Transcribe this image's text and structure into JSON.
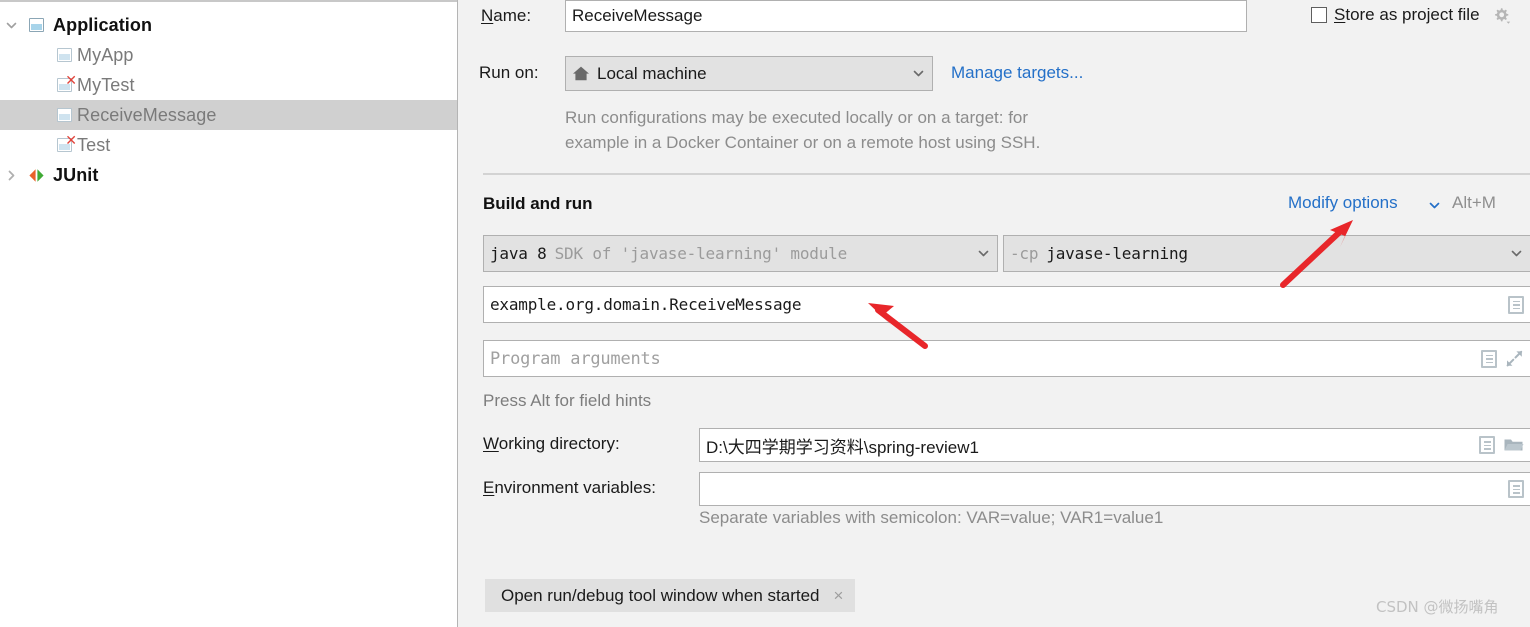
{
  "sidebar": {
    "items": [
      {
        "label": "Application",
        "icon": "window-icon",
        "indent": 0,
        "expander": "chevron-down-icon",
        "bold": true,
        "selected": false,
        "error": false
      },
      {
        "label": "MyApp",
        "icon": "window-icon",
        "indent": 1,
        "expander": "",
        "bold": false,
        "selected": false,
        "error": false
      },
      {
        "label": "MyTest",
        "icon": "window-error-icon",
        "indent": 1,
        "expander": "",
        "bold": false,
        "selected": false,
        "error": true
      },
      {
        "label": "ReceiveMessage",
        "icon": "window-icon",
        "indent": 1,
        "expander": "",
        "bold": false,
        "selected": true,
        "error": false
      },
      {
        "label": "Test",
        "icon": "window-error-icon",
        "indent": 1,
        "expander": "",
        "bold": false,
        "selected": false,
        "error": true
      },
      {
        "label": "JUnit",
        "icon": "junit-icon",
        "indent": 0,
        "expander": "chevron-right-icon",
        "bold": true,
        "selected": false,
        "error": false
      }
    ]
  },
  "form": {
    "name_label": "Name:",
    "name_value": "ReceiveMessage",
    "store_as_project_file_label": "Store as project file",
    "store_as_project_file_checked": false,
    "run_on_label": "Run on:",
    "run_on_value": "Local machine",
    "manage_targets_link": "Manage targets...",
    "run_on_description_line1": "Run configurations may be executed locally or on a target: for",
    "run_on_description_line2": "example in a Docker Container or on a remote host using SSH.",
    "build_and_run_title": "Build and run",
    "modify_options_link": "Modify options",
    "modify_options_shortcut": "Alt+M",
    "jdk_value_strong": "java 8",
    "jdk_value_dim": "SDK of 'javase-learning' module",
    "classpath_value_dim": "-cp",
    "classpath_value_strong": "javase-learning",
    "main_class_value": "example.org.domain.ReceiveMessage",
    "program_arguments_placeholder": "Program arguments",
    "field_hints_text": "Press Alt for field hints",
    "working_directory_label": "Working directory:",
    "working_directory_value": "D:\\大四学期学习资料\\spring-review1",
    "environment_variables_label": "Environment variables:",
    "environment_variables_value": "",
    "environment_variables_hint": "Separate variables with semicolon: VAR=value; VAR1=value1",
    "open_tool_window_chip_label": "Open run/debug tool window when started",
    "open_tool_window_chip_close": "×"
  },
  "watermark": {
    "text": "CSDN @微扬嘴角"
  },
  "colors": {
    "accent_link": "#2470c8",
    "annotation_arrow": "#e8262a",
    "selection": "#d0d0d0",
    "panel_bg": "#f2f2f2",
    "error_marker": "#e2433a"
  }
}
